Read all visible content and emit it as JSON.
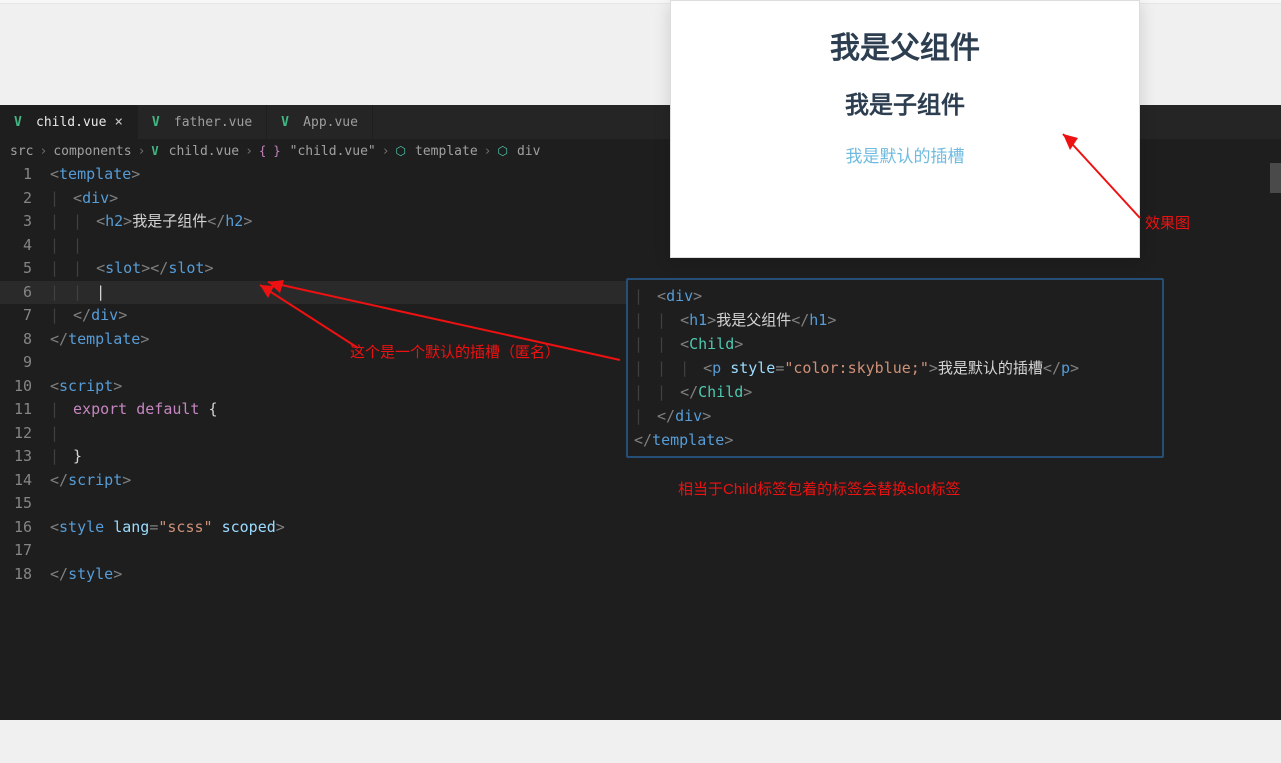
{
  "preview": {
    "h1": "我是父组件",
    "h2": "我是子组件",
    "p": "我是默认的插槽"
  },
  "tabs": [
    {
      "label": "child.vue",
      "active": true,
      "closeable": true
    },
    {
      "label": "father.vue",
      "active": false,
      "closeable": false
    },
    {
      "label": "App.vue",
      "active": false,
      "closeable": false
    }
  ],
  "breadcrumbs": [
    {
      "label": "src",
      "icon": null
    },
    {
      "label": "components",
      "icon": null
    },
    {
      "label": "child.vue",
      "icon": "v"
    },
    {
      "label": "\"child.vue\"",
      "icon": "brc"
    },
    {
      "label": "template",
      "icon": "cube"
    },
    {
      "label": "div",
      "icon": "cube"
    }
  ],
  "code_lines": [
    "1",
    "2",
    "3",
    "4",
    "5",
    "6",
    "7",
    "8",
    "9",
    "10",
    "11",
    "12",
    "13",
    "14",
    "15",
    "16",
    "17",
    "18"
  ],
  "child_code": {
    "l3_text": "我是子组件",
    "l11_keywords": {
      "export": "export",
      "default": "default"
    },
    "l16_attr": "lang",
    "l16_val": "\"scss\"",
    "l16_scoped": "scoped"
  },
  "snippet2": {
    "h1_text": "我是父组件",
    "style_attr": "style",
    "style_val": "\"color:skyblue;\"",
    "p_text": "我是默认的插槽"
  },
  "annotations": {
    "a1": "这个是一个默认的插槽（匿名）",
    "a2": "相当于Child标签包着的标签会替换slot标签",
    "a3": "效果图"
  }
}
